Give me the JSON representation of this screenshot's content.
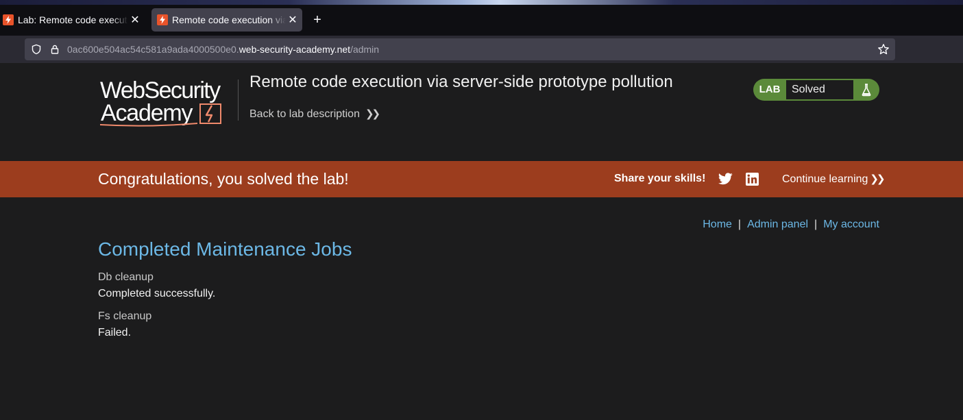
{
  "browser": {
    "tabs": [
      {
        "title": "Lab: Remote code execution via server-side prototype pollution",
        "active": false
      },
      {
        "title": "Remote code execution via server-side prototype pollution",
        "active": true
      }
    ],
    "new_tab_label": "+",
    "close_glyph": "✕",
    "url": {
      "prefix": "0ac600e504ac54c581a9ada4000500e0.",
      "domain": "web-security-academy.net",
      "path": "/admin"
    }
  },
  "header": {
    "logo_line1": "WebSecurity",
    "logo_line2": "Academy",
    "lab_title": "Remote code execution via server-side prototype pollution",
    "back_link": "Back to lab description",
    "status": {
      "badge": "LAB",
      "text": "Solved",
      "icon": "flask-icon"
    }
  },
  "banner": {
    "message": "Congratulations, you solved the lab!",
    "share_label": "Share your skills!",
    "continue_label": "Continue learning"
  },
  "nav": {
    "home": "Home",
    "admin_panel": "Admin panel",
    "my_account": "My account",
    "separator": "|"
  },
  "main": {
    "title": "Completed Maintenance Jobs",
    "jobs": [
      {
        "name": "Db cleanup",
        "status": "Completed successfully."
      },
      {
        "name": "Fs cleanup",
        "status": "Failed."
      }
    ]
  },
  "colors": {
    "banner": "#9c3d1e",
    "link": "#6cb8e6",
    "solved_green": "#5b8a3a",
    "page_bg": "#1c1c1d"
  }
}
